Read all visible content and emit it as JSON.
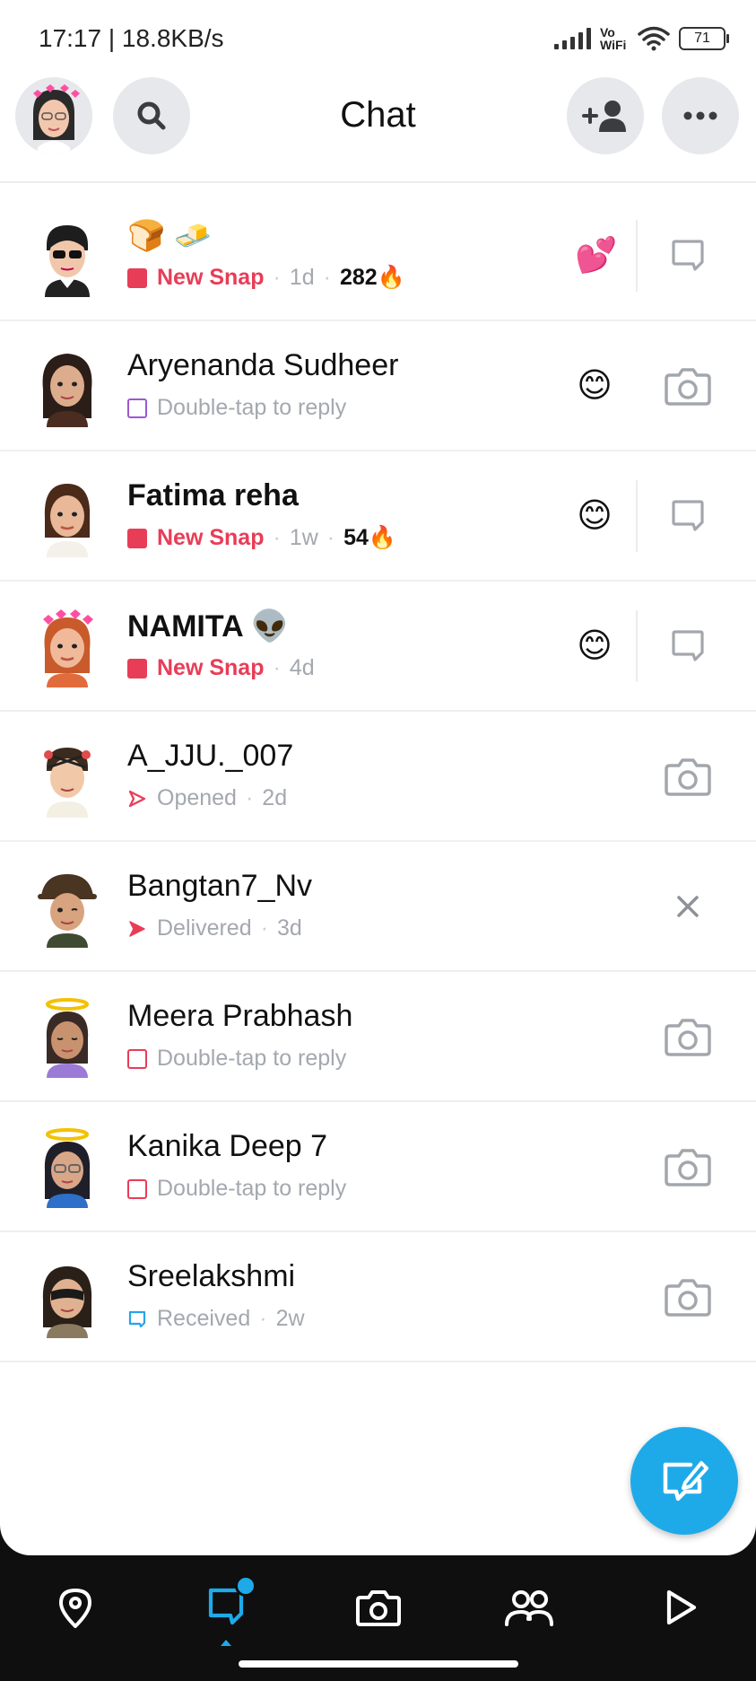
{
  "status_bar": {
    "time_speed": "17:17 | 18.8KB/s",
    "network_line1": "Vo",
    "network_line2": "WiFi",
    "battery": "71"
  },
  "header": {
    "title": "Chat",
    "avatar_icon": "bitmoji-avatar-icon",
    "search_icon": "search-icon",
    "add_friend_icon": "add-friend-icon",
    "more_icon": "more-icon"
  },
  "chats": [
    {
      "name": "🍞 🧈",
      "status": "New Snap",
      "time": "1d",
      "streak": "282🔥",
      "emoji": "💕",
      "action_icon": "chat-icon"
    },
    {
      "name": "Aryenanda Sudheer",
      "status": "Double-tap to reply",
      "emoji": "😊",
      "action_icon": "camera-icon"
    },
    {
      "name": "Fatima reha",
      "status": "New Snap",
      "time": "1w",
      "streak": "54🔥",
      "emoji": "😊",
      "action_icon": "chat-icon"
    },
    {
      "name": "NAMITA 👽",
      "status": "New Snap",
      "time": "4d",
      "emoji": "😊",
      "action_icon": "chat-icon"
    },
    {
      "name": "A_JJU._007",
      "status": "Opened",
      "time": "2d",
      "action_icon": "camera-icon"
    },
    {
      "name": "Bangtan7_Nv",
      "status": "Delivered",
      "time": "3d",
      "action_icon": "close-icon"
    },
    {
      "name": "Meera Prabhash",
      "status": "Double-tap to reply",
      "action_icon": "camera-icon"
    },
    {
      "name": "Kanika Deep 7",
      "status": "Double-tap to reply",
      "action_icon": "camera-icon"
    },
    {
      "name": "Sreelakshmi",
      "status": "Received",
      "time": "2w",
      "action_icon": "camera-icon"
    }
  ],
  "fab_icon": "new-chat-icon",
  "nav": {
    "items": [
      "map-icon",
      "chat-icon",
      "camera-icon",
      "friends-icon",
      "stories-icon"
    ],
    "active": "chat-icon"
  },
  "colors": {
    "accent": "#1eaae9",
    "new_snap": "#e83d57",
    "purple": "#9b59d0",
    "received_blue": "#2aa3e6"
  }
}
